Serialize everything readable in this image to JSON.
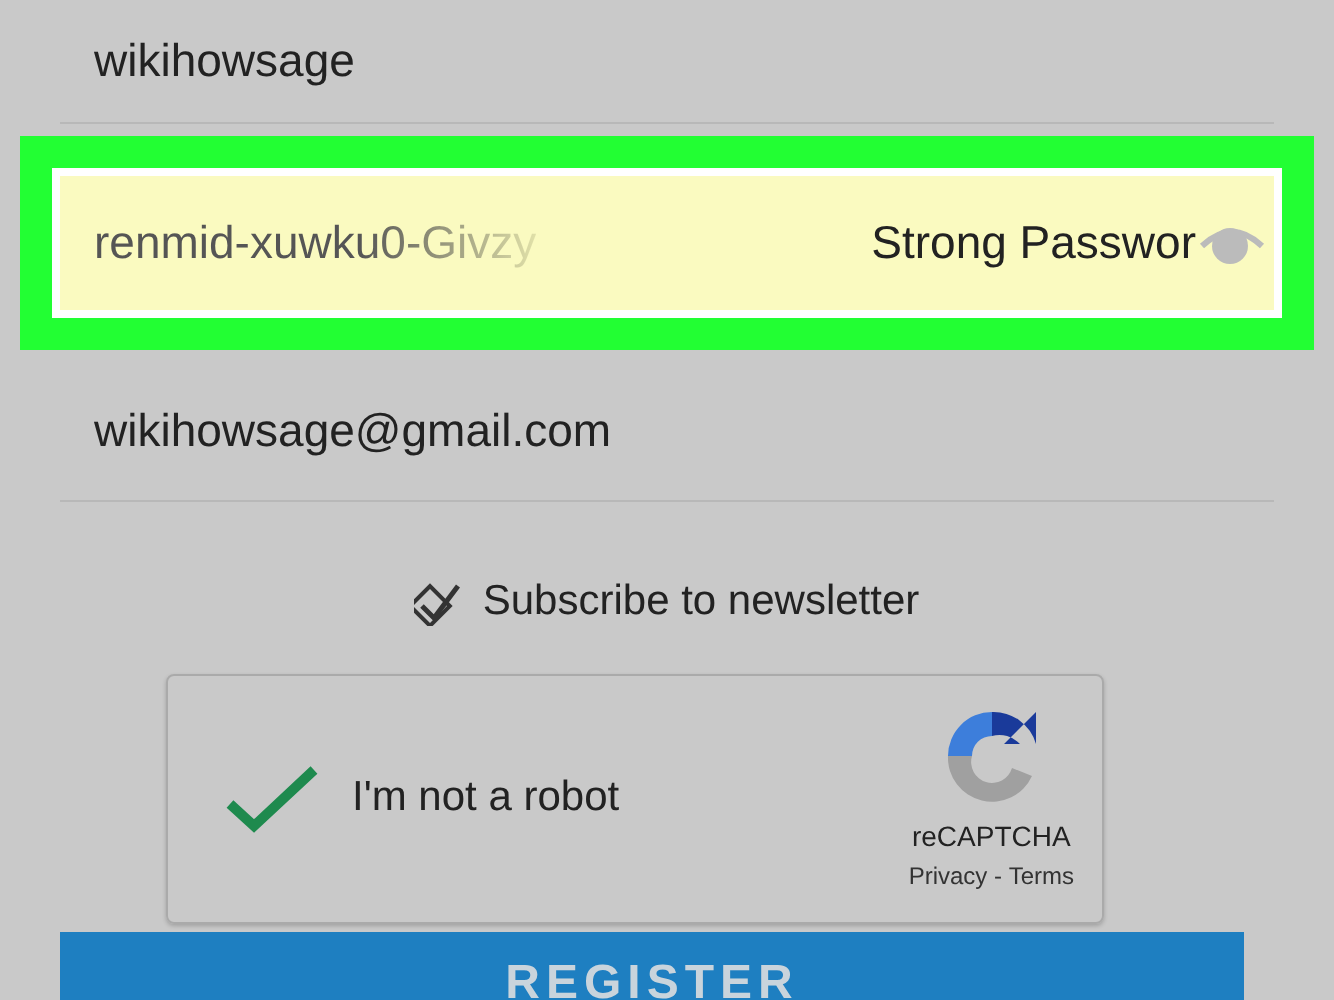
{
  "form": {
    "username": {
      "value": "wikihowsage"
    },
    "password": {
      "value": "renmid-xuwku0-Givzy",
      "hint": "Strong Passwor",
      "highlighted": true
    },
    "email": {
      "value": "wikihowsage@gmail.com"
    },
    "newsletter": {
      "label": "Subscribe to newsletter",
      "checked": true
    },
    "captcha": {
      "label": "I'm not a robot",
      "checked": true,
      "brand": "reCAPTCHA",
      "links": [
        {
          "label": "Privacy"
        },
        {
          "label": "Terms"
        }
      ],
      "separator": " - "
    },
    "submit": {
      "label": "REGISTER"
    }
  }
}
